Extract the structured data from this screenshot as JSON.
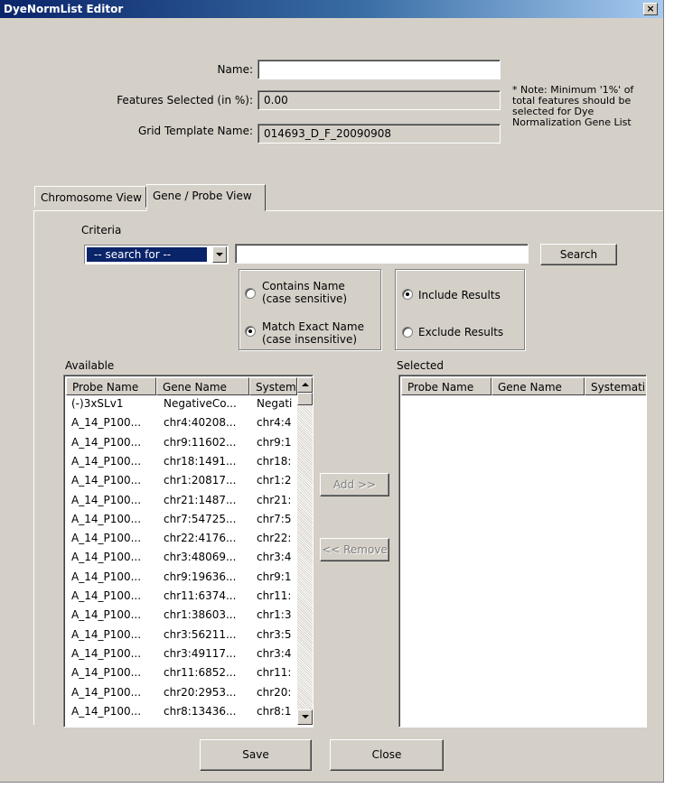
{
  "window": {
    "title": "DyeNormList Editor",
    "close_glyph": "×"
  },
  "form": {
    "name_label": "Name:",
    "name_value": "",
    "features_label": "Features Selected (in %):",
    "features_value": "0.00",
    "grid_label": "Grid Template Name:",
    "grid_value": "014693_D_F_20090908",
    "note_line1": "* Note: Minimum '1%' of",
    "note_line2": "total features should be",
    "note_line3": "selected for Dye",
    "note_line4": "Normalization Gene List"
  },
  "tabs": [
    {
      "label": "Chromosome View",
      "active": false
    },
    {
      "label": "Gene / Probe View",
      "active": true
    }
  ],
  "criteria": {
    "label": "Criteria",
    "search_for": "-- search for --",
    "search_value": "",
    "search_button": "Search",
    "match_options": [
      {
        "line1": "Contains Name",
        "line2": "(case sensitive)",
        "selected": false
      },
      {
        "line1": "Match Exact Name",
        "line2": "(case insensitive)",
        "selected": true
      }
    ],
    "result_options": [
      {
        "label": "Include Results",
        "selected": true
      },
      {
        "label": "Exclude Results",
        "selected": false
      }
    ]
  },
  "available": {
    "label": "Available",
    "columns": [
      "Probe Name",
      "Gene Name",
      "Systematic Name"
    ],
    "rows": [
      [
        "(-)3xSLv1",
        "NegativeCo...",
        "Negati"
      ],
      [
        "A_14_P100...",
        "chr4:40208...",
        "chr4:4"
      ],
      [
        "A_14_P100...",
        "chr9:11602...",
        "chr9:1"
      ],
      [
        "A_14_P100...",
        "chr18:1491...",
        "chr18:"
      ],
      [
        "A_14_P100...",
        "chr1:20817...",
        "chr1:2"
      ],
      [
        "A_14_P100...",
        "chr21:1487...",
        "chr21:"
      ],
      [
        "A_14_P100...",
        "chr7:54725...",
        "chr7:5"
      ],
      [
        "A_14_P100...",
        "chr22:4176...",
        "chr22:"
      ],
      [
        "A_14_P100...",
        "chr3:48069...",
        "chr3:4"
      ],
      [
        "A_14_P100...",
        "chr9:19636...",
        "chr9:1"
      ],
      [
        "A_14_P100...",
        "chr11:6374...",
        "chr11:"
      ],
      [
        "A_14_P100...",
        "chr1:38603...",
        "chr1:3"
      ],
      [
        "A_14_P100...",
        "chr3:56211...",
        "chr3:5"
      ],
      [
        "A_14_P100...",
        "chr3:49117...",
        "chr3:4"
      ],
      [
        "A_14_P100...",
        "chr11:6852...",
        "chr11:"
      ],
      [
        "A_14_P100...",
        "chr20:2953...",
        "chr20:"
      ],
      [
        "A_14_P100...",
        "chr8:13436...",
        "chr8:1"
      ]
    ]
  },
  "selected": {
    "label": "Selected",
    "columns": [
      "Probe Name",
      "Gene Name",
      "Systemati"
    ],
    "rows": []
  },
  "transfer": {
    "add_label": "Add >>",
    "remove_label": "<< Remove"
  },
  "footer": {
    "save_label": "Save",
    "close_label": "Close"
  }
}
